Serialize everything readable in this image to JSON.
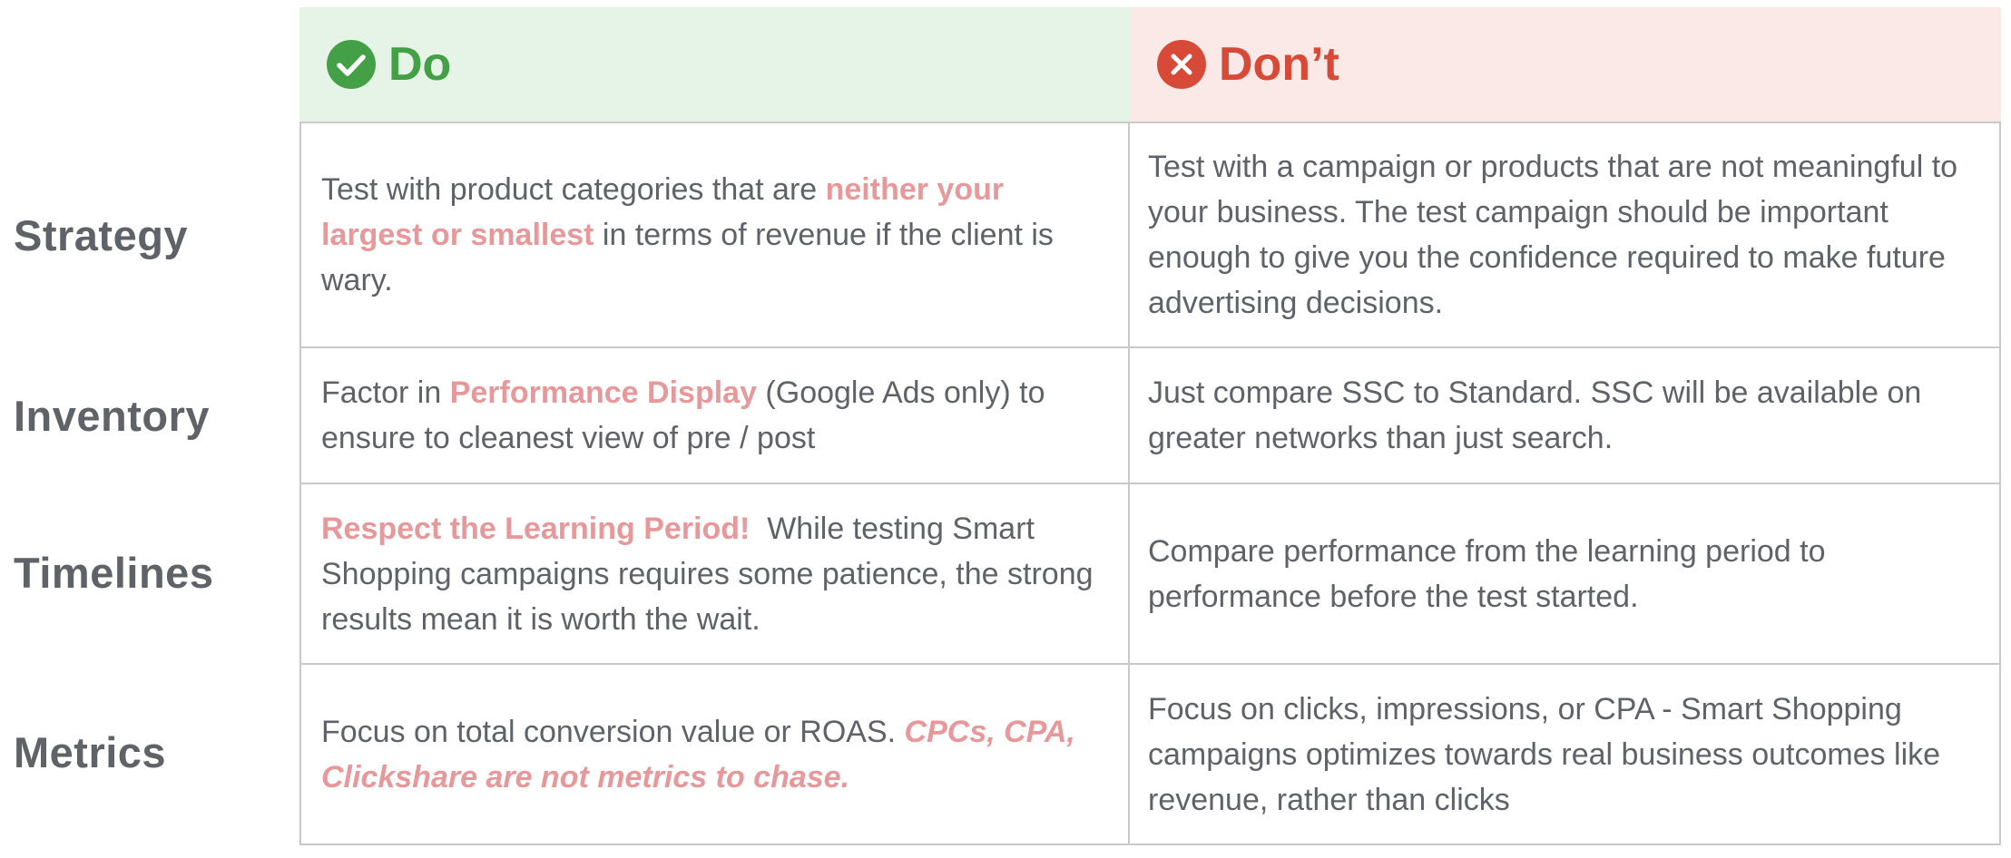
{
  "header": {
    "do_label": "Do",
    "dont_label": "Don’t",
    "do_icon": "check-circle-icon",
    "dont_icon": "x-circle-icon",
    "do_color": "#43a047",
    "dont_color": "#d84a38",
    "do_bg": "#e6f3e7",
    "dont_bg": "#fbe9e7",
    "highlight_color": "#e6989a"
  },
  "rows": [
    {
      "label": "Strategy",
      "do": {
        "t1": "Test with product categories that are ",
        "h1": "neither your largest or smallest",
        "t2": " in terms of revenue if the client is wary."
      },
      "dont": "Test with a campaign or products that are not meaningful to your business.  The test campaign should be important enough to give you the confidence required to make future advertising decisions."
    },
    {
      "label": "Inventory",
      "do": {
        "t1": "Factor in ",
        "h1": "Performance Display",
        "t2": " (Google Ads only) to ensure to cleanest view of pre / post"
      },
      "dont": "Just compare SSC to Standard. SSC will be available on greater networks than just search."
    },
    {
      "label": "Timelines",
      "do": {
        "h1": "Respect the Learning Period!",
        "t2": "  While testing Smart Shopping campaigns requires some patience, the strong results mean it is worth the wait."
      },
      "dont": "Compare performance from the learning period to performance before the test started."
    },
    {
      "label": "Metrics",
      "do": {
        "t1": "Focus on total conversion value or ROAS. ",
        "h1": "CPCs, CPA, Clickshare are not metrics to chase."
      },
      "dont": "Focus on clicks, impressions, or CPA - Smart Shopping campaigns optimizes towards real business outcomes like revenue, rather than clicks"
    }
  ]
}
